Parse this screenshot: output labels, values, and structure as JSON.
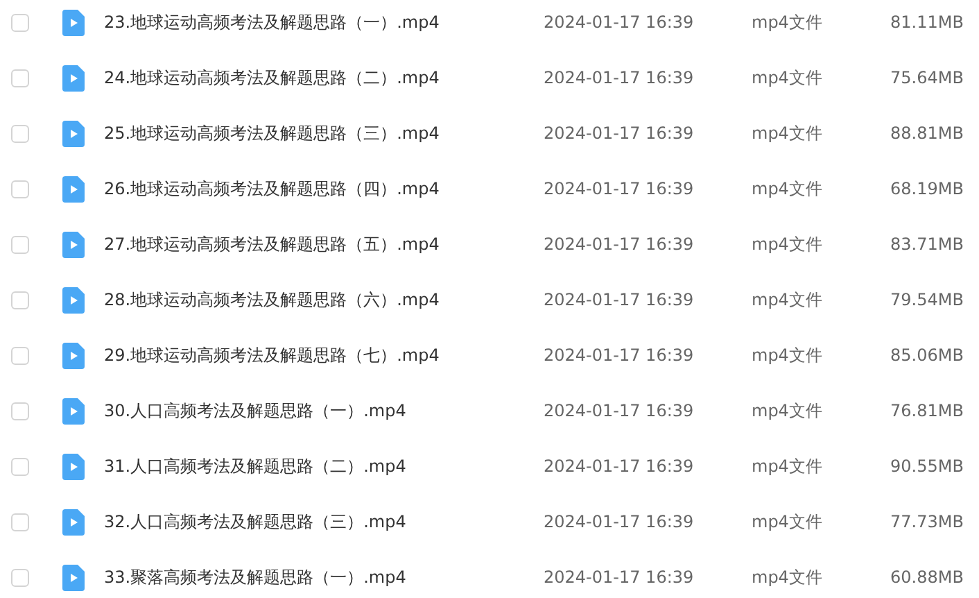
{
  "files": [
    {
      "name": "23.地球运动高频考法及解题思路（一）.mp4",
      "checked": false,
      "date": "2024-01-17 16:39",
      "type": "mp4文件",
      "size": "81.11MB"
    },
    {
      "name": "24.地球运动高频考法及解题思路（二）.mp4",
      "checked": false,
      "date": "2024-01-17 16:39",
      "type": "mp4文件",
      "size": "75.64MB"
    },
    {
      "name": "25.地球运动高频考法及解题思路（三）.mp4",
      "checked": false,
      "date": "2024-01-17 16:39",
      "type": "mp4文件",
      "size": "88.81MB"
    },
    {
      "name": "26.地球运动高频考法及解题思路（四）.mp4",
      "checked": false,
      "date": "2024-01-17 16:39",
      "type": "mp4文件",
      "size": "68.19MB"
    },
    {
      "name": "27.地球运动高频考法及解题思路（五）.mp4",
      "checked": false,
      "date": "2024-01-17 16:39",
      "type": "mp4文件",
      "size": "83.71MB"
    },
    {
      "name": "28.地球运动高频考法及解题思路（六）.mp4",
      "checked": false,
      "date": "2024-01-17 16:39",
      "type": "mp4文件",
      "size": "79.54MB"
    },
    {
      "name": "29.地球运动高频考法及解题思路（七）.mp4",
      "checked": false,
      "date": "2024-01-17 16:39",
      "type": "mp4文件",
      "size": "85.06MB"
    },
    {
      "name": "30.人口高频考法及解题思路（一）.mp4",
      "checked": false,
      "date": "2024-01-17 16:39",
      "type": "mp4文件",
      "size": "76.81MB"
    },
    {
      "name": "31.人口高频考法及解题思路（二）.mp4",
      "checked": false,
      "date": "2024-01-17 16:39",
      "type": "mp4文件",
      "size": "90.55MB"
    },
    {
      "name": "32.人口高频考法及解题思路（三）.mp4",
      "checked": false,
      "date": "2024-01-17 16:39",
      "type": "mp4文件",
      "size": "77.73MB"
    },
    {
      "name": "33.聚落高频考法及解题思路（一）.mp4",
      "checked": false,
      "date": "2024-01-17 16:39",
      "type": "mp4文件",
      "size": "60.88MB"
    }
  ]
}
